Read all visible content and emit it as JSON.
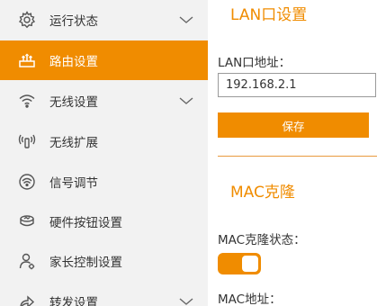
{
  "sidebar": {
    "items": [
      {
        "label": "运行状态",
        "icon": "gear-icon",
        "expandable": true,
        "active": false
      },
      {
        "label": "路由设置",
        "icon": "router-icon",
        "expandable": false,
        "active": true
      },
      {
        "label": "无线设置",
        "icon": "wifi-icon",
        "expandable": true,
        "active": false
      },
      {
        "label": "无线扩展",
        "icon": "wireless-extend-icon",
        "expandable": false,
        "active": false
      },
      {
        "label": "信号调节",
        "icon": "signal-adjust-icon",
        "expandable": false,
        "active": false
      },
      {
        "label": "硬件按钮设置",
        "icon": "hardware-button-icon",
        "expandable": false,
        "active": false
      },
      {
        "label": "家长控制设置",
        "icon": "parental-control-icon",
        "expandable": false,
        "active": false
      },
      {
        "label": "转发设置",
        "icon": "forward-icon",
        "expandable": true,
        "active": false
      }
    ]
  },
  "lan": {
    "title": "LAN口设置",
    "address_label": "LAN口地址：",
    "address_value": "192.168.2.1",
    "save_label": "保存"
  },
  "mac": {
    "title": "MAC克隆",
    "status_label": "MAC克隆状态：",
    "status_on": true,
    "address_label": "MAC地址："
  },
  "colors": {
    "accent": "#f08c00",
    "sidebar_bg": "#f2f2f2"
  }
}
